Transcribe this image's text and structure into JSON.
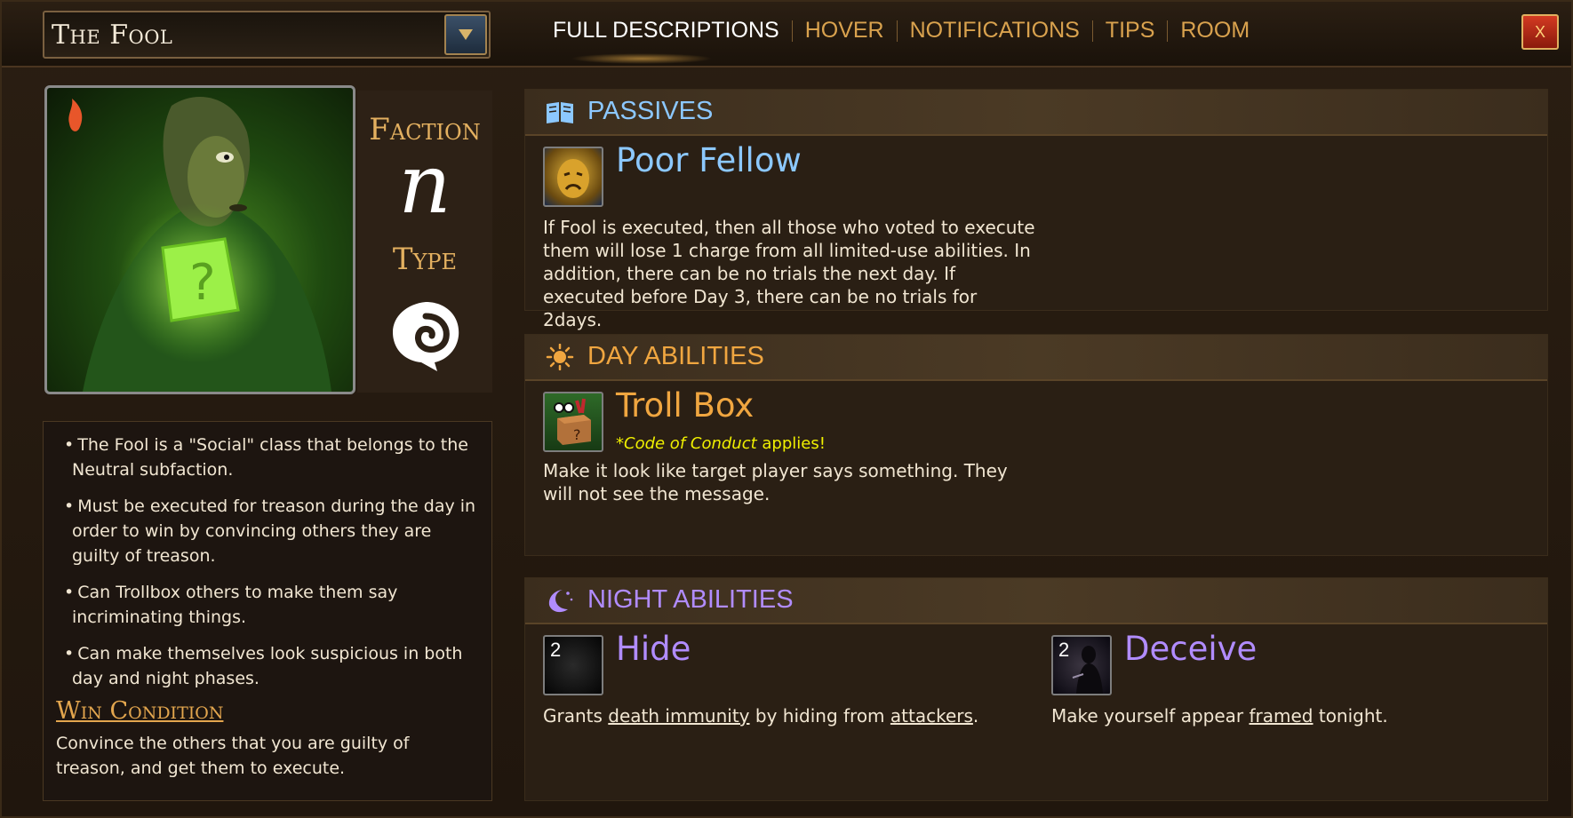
{
  "header": {
    "role_name": "The Fool",
    "tabs": [
      "FULL DESCRIPTIONS",
      "HOVER",
      "NOTIFICATIONS",
      "TIPS",
      "ROOM"
    ],
    "active_tab": "FULL DESCRIPTIONS",
    "close_label": "X"
  },
  "meta": {
    "faction_label": "Faction",
    "faction_symbol": "n",
    "type_label": "Type"
  },
  "description": {
    "bullets": [
      "The Fool is a \"Social\" class that belongs to the Neutral subfaction.",
      "Must be executed for treason during the day in order to win by convincing others they are guilty of treason.",
      "Can Trollbox others to make them say incriminating things.",
      "Can make themselves look suspicious in both day and night phases."
    ],
    "win_title": "Win Condition",
    "win_text": "Convince the others that you are guilty of treason, and get them to execute."
  },
  "passives": {
    "title": "PASSIVES",
    "color": "#8cc8ff",
    "ability": {
      "name": "Poor Fellow",
      "text": "If Fool is executed, then all those who voted to execute them will lose 1 charge from all limited-use abilities. In addition, there can be no trials the next day. If executed before Day 3, there can be no trials for 2days."
    }
  },
  "day": {
    "title": "DAY ABILITIES",
    "color": "#f0a640",
    "ability": {
      "name": "Troll Box",
      "note_prefix": "*",
      "note_italic": "Code of Conduct",
      "note_suffix": " applies!",
      "text": "Make it look like target player says something. They will not see the message."
    }
  },
  "night": {
    "title": "NIGHT ABILITIES",
    "color": "#b18cff",
    "abilities": [
      {
        "name": "Hide",
        "uses": "2",
        "text_a": "Grants ",
        "link1": "death immunity",
        "text_b": " by hiding from ",
        "link2": "attackers",
        "text_c": "."
      },
      {
        "name": "Deceive",
        "uses": "2",
        "text_a": "Make yourself appear ",
        "link1": "framed",
        "text_b": " tonight."
      }
    ]
  }
}
